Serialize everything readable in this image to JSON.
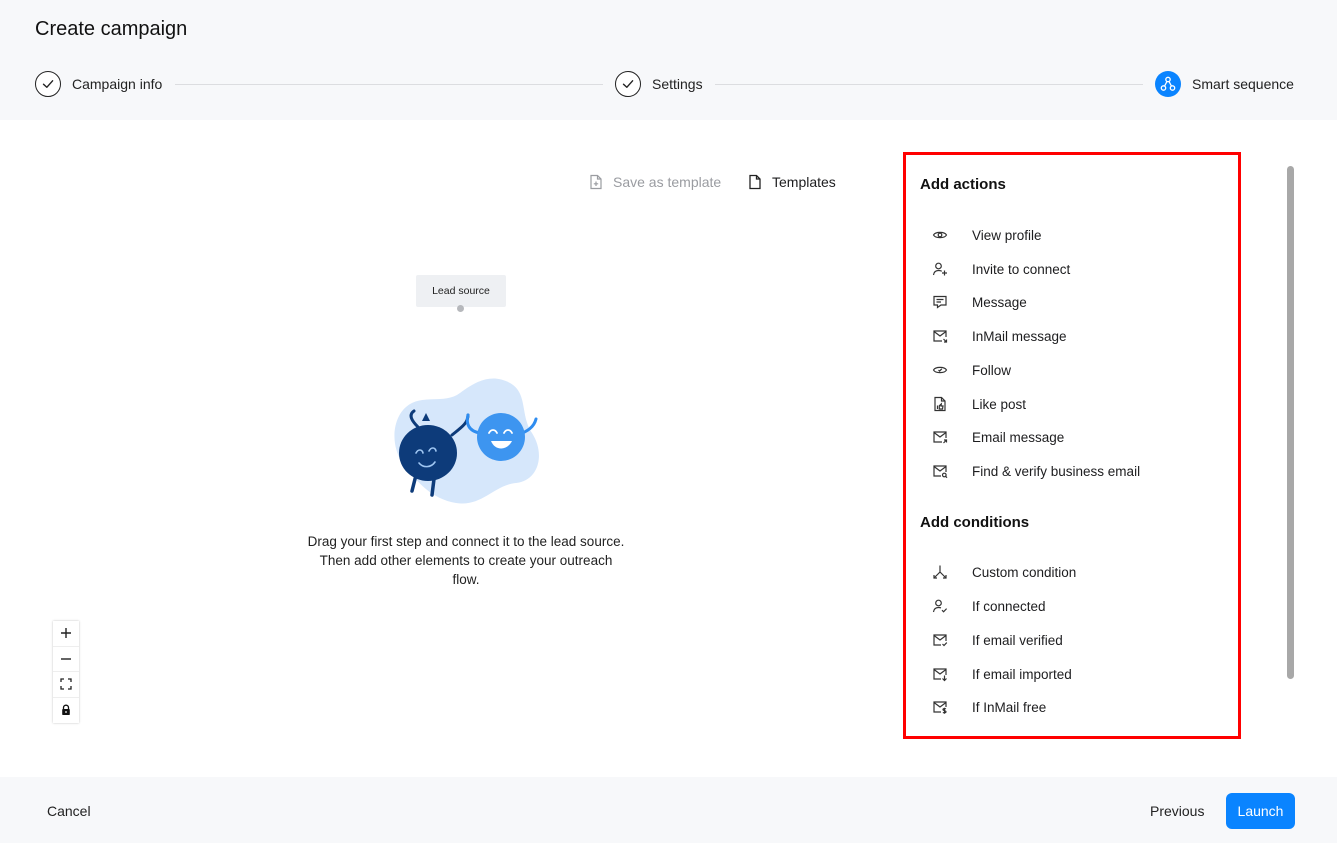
{
  "header": {
    "title": "Create campaign",
    "steps": [
      {
        "label": "Campaign info",
        "icon": "check-icon",
        "state": "done"
      },
      {
        "label": "Settings",
        "icon": "check-icon",
        "state": "done"
      },
      {
        "label": "Smart sequence",
        "icon": "sequence-icon",
        "state": "active"
      }
    ]
  },
  "toolbar": {
    "save_template": "Save as template",
    "templates": "Templates"
  },
  "canvas": {
    "lead_source": "Lead source",
    "empty_message": "Drag your first step and connect it to the lead source. Then add other elements to create your outreach flow."
  },
  "panel": {
    "actions_heading": "Add actions",
    "actions": [
      {
        "label": "View profile",
        "icon": "eye-icon"
      },
      {
        "label": "Invite to connect",
        "icon": "user-plus-icon"
      },
      {
        "label": "Message",
        "icon": "message-icon"
      },
      {
        "label": "InMail message",
        "icon": "inmail-icon"
      },
      {
        "label": "Follow",
        "icon": "follow-icon"
      },
      {
        "label": "Like post",
        "icon": "like-icon"
      },
      {
        "label": "Email message",
        "icon": "email-icon"
      },
      {
        "label": "Find & verify business email",
        "icon": "email-verify-icon"
      }
    ],
    "conditions_heading": "Add conditions",
    "conditions": [
      {
        "label": "Custom condition",
        "icon": "branch-icon"
      },
      {
        "label": "If connected",
        "icon": "user-check-icon"
      },
      {
        "label": "If email verified",
        "icon": "email-check-icon"
      },
      {
        "label": "If email imported",
        "icon": "email-import-icon"
      },
      {
        "label": "If InMail free",
        "icon": "inmail-free-icon"
      }
    ]
  },
  "footer": {
    "cancel": "Cancel",
    "previous": "Previous",
    "launch": "Launch"
  },
  "colors": {
    "accent": "#0a84ff",
    "highlight_border": "#ff0000",
    "header_bg": "#f7f8fa"
  }
}
